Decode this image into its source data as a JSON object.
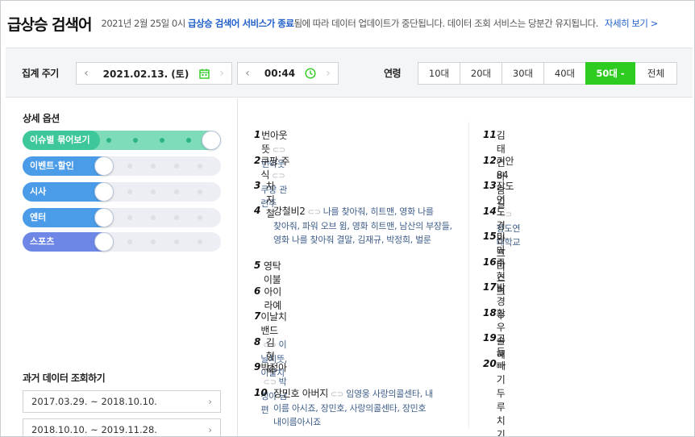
{
  "header": {
    "title": "급상승 검색어",
    "notice_pre": "2021년 2월 25일 0시 ",
    "notice_hl": "급상승 검색어 서비스가 종료",
    "notice_post": "됨에 따라 데이터 업데이트가 중단됩니다. 데이터 조회 서비스는 당분간 유지됩니다.",
    "more": "자세히 보기 >"
  },
  "toolbar": {
    "period_label": "집계 주기",
    "date": "2021.02.13. (토)",
    "time": "00:44",
    "age_label": "연령",
    "ages": [
      "10대",
      "20대",
      "30대",
      "40대",
      "50대 -",
      "전체"
    ],
    "active_age": "50대 -",
    "accent": "#2ecc20"
  },
  "sidebar": {
    "options_title": "상세 옵션",
    "options": [
      {
        "label": "이슈별 묶어보기",
        "on": true,
        "color": "#3ec79a"
      },
      {
        "label": "이벤트·할인",
        "on": false,
        "color": "#4a9be8"
      },
      {
        "label": "시사",
        "on": false,
        "color": "#4a9be8"
      },
      {
        "label": "엔터",
        "on": false,
        "color": "#4a9be8"
      },
      {
        "label": "스포츠",
        "on": false,
        "color": "#6e86e6"
      }
    ],
    "past_title": "과거 데이터 조회하기",
    "past": [
      "2017.03.29. ~ 2018.10.10.",
      "2018.10.10. ~ 2019.11.28."
    ]
  },
  "ranks_left": [
    {
      "n": "1",
      "kw": "번아웃 뜻",
      "rel": "번아웃"
    },
    {
      "n": "2",
      "kw": "쿠팡 주식",
      "rel": "쿠팡 관련주"
    },
    {
      "n": "3",
      "kw": "차지철",
      "rel": ""
    },
    {
      "n": "4",
      "kw": "강철비2",
      "rel": "나를 찾아줘, 히트맨, 영화 나를",
      "rel2": "찾아줘, 파워 오브 윔, 영화 히트맨, 남산의 부장들,",
      "rel3": "영화 나를 찾아줘 결말, 김재규, 박정희, 벌룬"
    },
    {
      "n": "5",
      "kw": "영탁 이불",
      "rel": ""
    },
    {
      "n": "6",
      "kw": "아이라예",
      "rel": ""
    },
    {
      "n": "7",
      "kw": "이날치밴드",
      "rel": "이날치뜻, 이날치"
    },
    {
      "n": "8",
      "kw": "김형욱",
      "rel": ""
    },
    {
      "n": "9",
      "kw": "박정아",
      "rel": "박정아 남편"
    },
    {
      "n": "10",
      "kw": "장민호 아버지",
      "rel": "임영웅 사랑의콜센타, 내",
      "rel2": "이름 아시죠, 장민호, 사랑의콜센타, 장민호",
      "rel3": "내이름아시죠"
    }
  ],
  "ranks_right": [
    {
      "n": "11",
      "kw": "김태연 바람길",
      "rel": ""
    },
    {
      "n": "12",
      "kw": "기안84",
      "rel": ""
    },
    {
      "n": "13",
      "kw": "장도연",
      "rel": "장도연 대학교"
    },
    {
      "n": "14",
      "kw": "도경완 프리",
      "rel": ""
    },
    {
      "n": "15",
      "kw": "미마마스크",
      "rel": ""
    },
    {
      "n": "16",
      "kw": "주현미",
      "rel": ""
    },
    {
      "n": "17",
      "kw": "박경수",
      "rel": ""
    },
    {
      "n": "18",
      "kw": "황우슬혜",
      "rel": ""
    },
    {
      "n": "19",
      "kw": "고들빼기두루치기",
      "rel": ""
    },
    {
      "n": "20",
      "kw": "-",
      "rel": ""
    }
  ]
}
